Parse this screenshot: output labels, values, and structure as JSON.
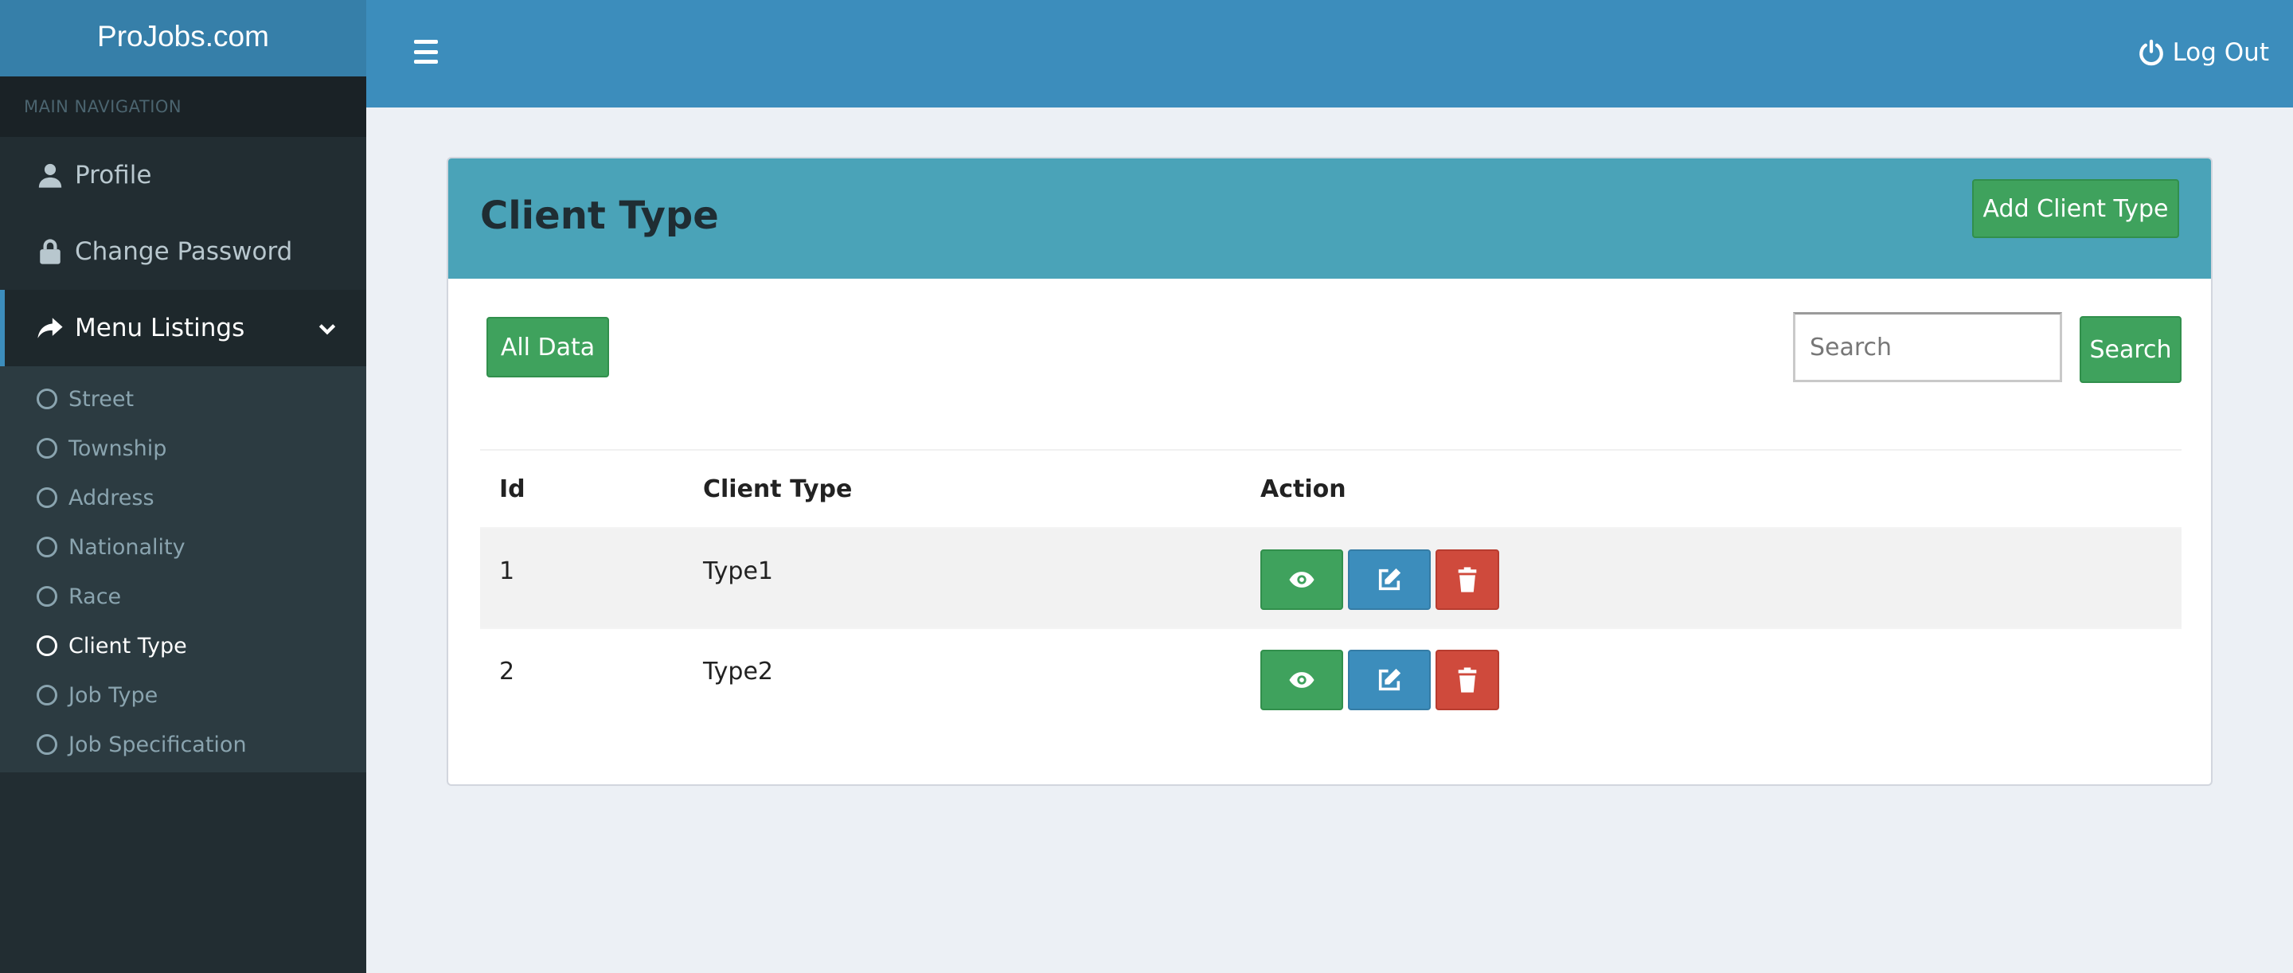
{
  "brand": "ProJobs.com",
  "sidebar": {
    "header": "MAIN NAVIGATION",
    "items": [
      {
        "label": "Profile",
        "icon": "user-icon"
      },
      {
        "label": "Change Password",
        "icon": "lock-icon"
      },
      {
        "label": "Menu Listings",
        "icon": "share-icon",
        "expanded": true
      }
    ],
    "submenu": [
      "Street",
      "Township",
      "Address",
      "Nationality",
      "Race",
      "Client Type",
      "Job Type",
      "Job Specification"
    ],
    "current_submenu": "Client Type"
  },
  "topbar": {
    "menu_icon": "hamburger-icon",
    "logout_label": "Log Out",
    "logout_icon": "power-icon"
  },
  "box": {
    "title": "Client Type",
    "add_label": "Add Client Type",
    "all_data_label": "All Data",
    "search_placeholder": "Search",
    "search_value": "",
    "search_label": "Search"
  },
  "table": {
    "columns": [
      "Id",
      "Client Type",
      "Action"
    ],
    "rows": [
      {
        "id": "1",
        "type": "Type1"
      },
      {
        "id": "2",
        "type": "Type2"
      }
    ],
    "action_icons": [
      "eye-icon",
      "edit-icon",
      "trash-icon"
    ]
  },
  "colors": {
    "topbar": "#3c8dbc",
    "logo_bg": "#367fa9",
    "sidebar": "#222d32",
    "box_header": "#4aa3b8",
    "success": "#3fa25d",
    "primary": "#3c8dbc",
    "danger": "#cf4a3c"
  }
}
